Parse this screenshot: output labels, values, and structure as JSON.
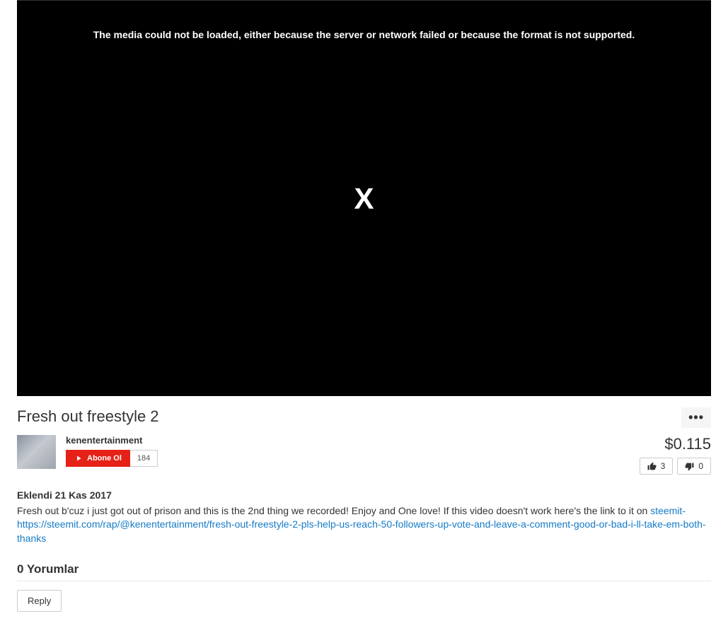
{
  "video": {
    "error_message": "The media could not be loaded, either because the server or network failed or because the format is not supported.",
    "error_x": "X",
    "title": "Fresh out freestyle 2"
  },
  "uploader": {
    "name": "kenentertainment",
    "subscribe_label": "Abone Ol",
    "subscriber_count": "184"
  },
  "stats": {
    "earnings": "$0.115",
    "likes": "3",
    "dislikes": "0"
  },
  "description": {
    "date": "Eklendi 21 Kas 2017",
    "text": "Fresh out b'cuz i just got out of prison and this is the 2nd thing we recorded! Enjoy and One love! If this video doesn't work here's the link to it on ",
    "link_text": "steemit- https://steemit.com/rap/@kenentertainment/fresh-out-freestyle-2-pls-help-us-reach-50-followers-up-vote-and-leave-a-comment-good-or-bad-i-ll-take-em-both-thanks"
  },
  "comments": {
    "header": "0 Yorumlar",
    "reply_label": "Reply"
  }
}
